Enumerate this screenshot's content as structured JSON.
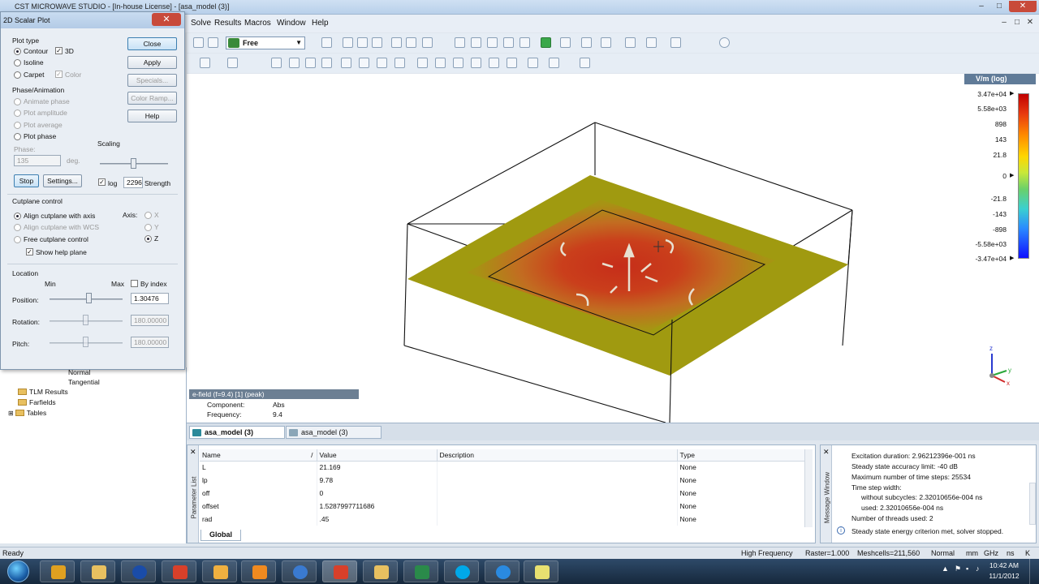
{
  "window": {
    "title": "CST MICROWAVE STUDIO - [In-house License] - [asa_model (3)]",
    "controls": {
      "minimize": "–",
      "maximize": "□",
      "close": "✕"
    },
    "inner_controls": {
      "minimize": "–",
      "restore": "□",
      "close": "✕"
    }
  },
  "menu": [
    "Solve",
    "Results",
    "Macros",
    "Window",
    "Help"
  ],
  "toolbar": {
    "view_mode": "Free"
  },
  "legend": {
    "title": "V/m (log)",
    "ticks": [
      "3.47e+04",
      "5.58e+03",
      "898",
      "143",
      "21.8",
      "0",
      "-21.8",
      "-143",
      "-898",
      "-5.58e+03",
      "-3.47e+04"
    ]
  },
  "field_info": {
    "header": "e-field (f=9.4) [1] (peak)",
    "component_label": "Component:",
    "component_value": "Abs",
    "frequency_label": "Frequency:",
    "frequency_value": "9.4"
  },
  "axes": {
    "z": "z",
    "y": "y",
    "x": "x"
  },
  "view_tabs": [
    {
      "label": "asa_model (3)",
      "active": true
    },
    {
      "label": "asa_model (3)",
      "active": false
    }
  ],
  "parameter_list": {
    "side_label": "Parameter List",
    "columns": [
      "Name",
      "Value",
      "Description",
      "Type"
    ],
    "sort_indicator": "/",
    "rows": [
      {
        "name": "L",
        "value": "21.169",
        "description": "",
        "type": "None"
      },
      {
        "name": "lp",
        "value": "9.78",
        "description": "",
        "type": "None"
      },
      {
        "name": "off",
        "value": "0",
        "description": "",
        "type": "None"
      },
      {
        "name": "offset",
        "value": "1.5287997711686",
        "description": "",
        "type": "None"
      },
      {
        "name": "rad",
        "value": ".45",
        "description": "",
        "type": "None"
      }
    ],
    "tab": "Global"
  },
  "message_window": {
    "side_label": "Message Window",
    "lines": [
      "Excitation duration: 2.96212396e-001 ns",
      "Steady state accuracy limit: -40 dB",
      "Maximum number of time steps: 25534",
      "Time step width:",
      "without subcycles: 2.32010656e-004 ns",
      "used: 2.32010656e-004 ns",
      "Number of threads used: 2"
    ],
    "info_line": "Steady state energy criterion met, solver stopped."
  },
  "tree": {
    "items": [
      "Normal",
      "Tangential",
      "TLM Results",
      "Farfields",
      "Tables"
    ]
  },
  "dialog": {
    "title": "2D Scalar Plot",
    "close_glyph": "✕",
    "plot_type_label": "Plot type",
    "contour": "Contour",
    "isoline": "Isoline",
    "carpet": "Carpet",
    "three_d": "3D",
    "color": "Color",
    "phase_animation_label": "Phase/Animation",
    "animate_phase": "Animate phase",
    "plot_amplitude": "Plot amplitude",
    "plot_average": "Plot average",
    "plot_phase": "Plot phase",
    "phase_label": "Phase:",
    "phase_value": "135",
    "phase_unit": "deg.",
    "scaling_label": "Scaling",
    "log_label": "log",
    "strength_value": "2296",
    "strength_label": "Strength",
    "stop": "Stop",
    "settings": "Settings...",
    "buttons": {
      "close": "Close",
      "apply": "Apply",
      "specials": "Specials...",
      "color_ramp": "Color Ramp...",
      "help": "Help"
    },
    "cutplane_label": "Cutplane control",
    "align_axis": "Align cutplane with axis",
    "align_wcs": "Align cutplane with WCS",
    "free_cutplane": "Free cutplane control",
    "show_help_plane": "Show help plane",
    "axis_label": "Axis:",
    "axis_x": "X",
    "axis_y": "Y",
    "axis_z": "Z",
    "location_label": "Location",
    "min_label": "Min",
    "max_label": "Max",
    "by_index": "By index",
    "position_label": "Position:",
    "position_value": "1.30476",
    "rotation_label": "Rotation:",
    "rotation_value": "180.00000",
    "pitch_label": "Pitch:",
    "pitch_value": "180.00000",
    "check_mark": "✓"
  },
  "status": {
    "ready": "Ready",
    "solver": "High Frequency",
    "raster": "Raster=1.000",
    "meshcells": "Meshcells=211,560",
    "mode": "Normal",
    "units": [
      "mm",
      "GHz",
      "ns",
      "K"
    ]
  },
  "taskbar": {
    "time": "10:42 AM",
    "date": "11/1/2012"
  },
  "colors": {
    "plane": "#a09a10",
    "hot": "#c8281a",
    "accent": "#607b98"
  }
}
